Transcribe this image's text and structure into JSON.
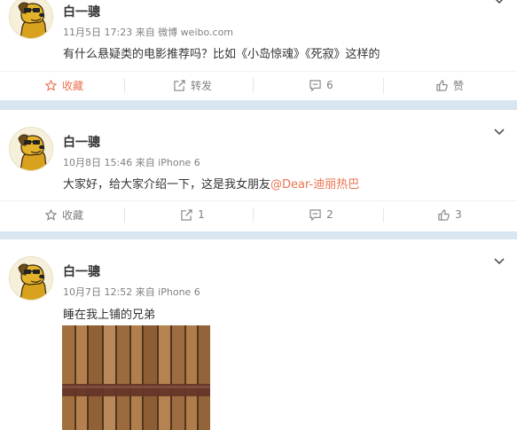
{
  "posts": [
    {
      "username": "白一骢",
      "meta": "11月5日 17:23 来自 微博 weibo.com",
      "content": "有什么悬疑类的电影推荐吗？比如《小岛惊魂》《死寂》这样的",
      "actions": {
        "favorite": "收藏",
        "repost": "转发",
        "comment": "6",
        "like": "赞"
      }
    },
    {
      "username": "白一骢",
      "meta": "10月8日 15:46 来自 iPhone 6",
      "content": "大家好，给大家介绍一下，这是我女朋友",
      "mention": "@Dear-迪丽热巴",
      "actions": {
        "favorite": "收藏",
        "repost": "1",
        "comment": "2",
        "like": "3"
      }
    },
    {
      "username": "白一骢",
      "meta": "10月7日 12:52 来自 iPhone 6",
      "content": "睡在我上铺的兄弟"
    }
  ],
  "colors": {
    "accent": "#eb7350",
    "muted": "#808080",
    "page_bg": "#d7e6f0"
  },
  "icons": [
    "avatar-dog-icon",
    "chevron-down-icon",
    "star-icon",
    "repost-icon",
    "comment-icon",
    "thumbs-up-icon"
  ]
}
